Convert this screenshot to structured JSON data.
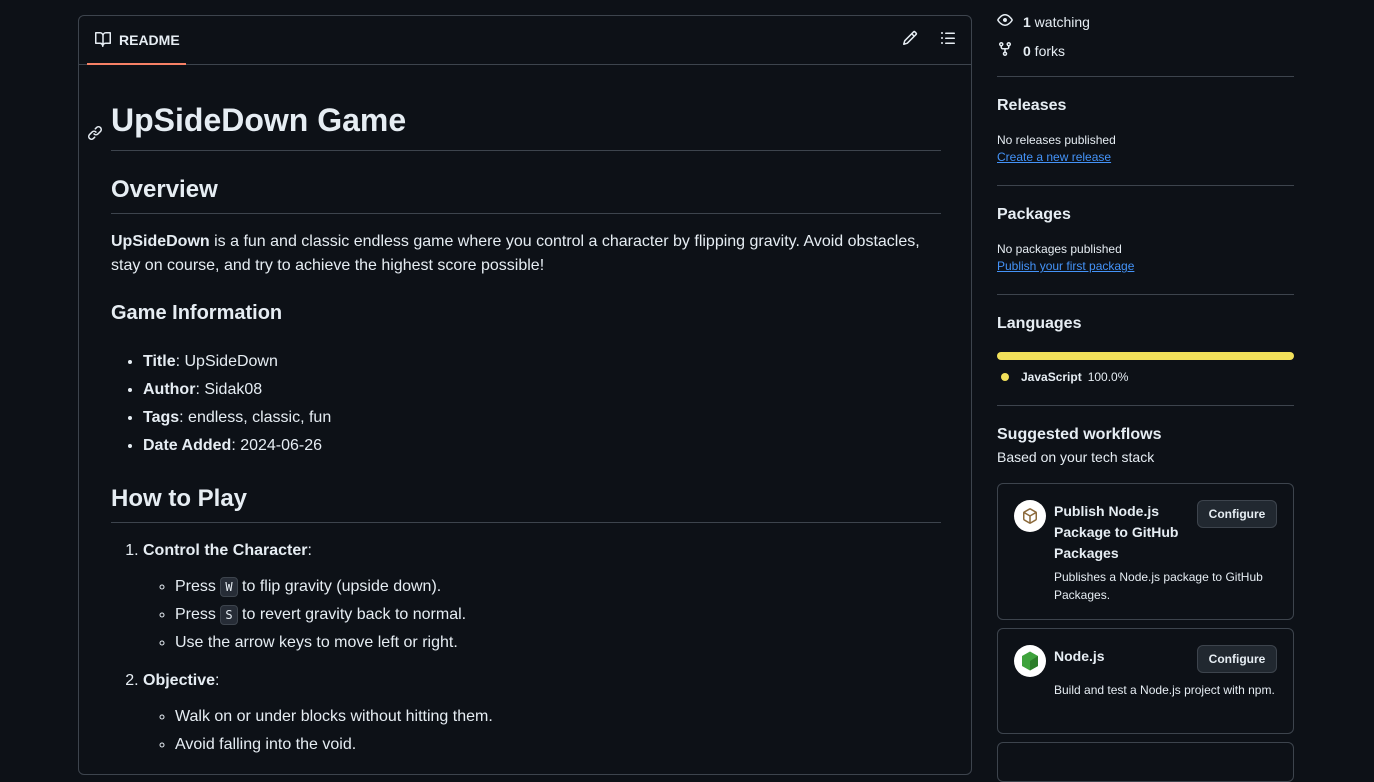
{
  "readme": {
    "tab_label": "README",
    "title": "UpSideDown Game",
    "overview_heading": "Overview",
    "overview_bold": "UpSideDown",
    "overview_text": " is a fun and classic endless game where you control a character by flipping gravity. Avoid obstacles, stay on course, and try to achieve the highest score possible!",
    "info_heading": "Game Information",
    "info": [
      {
        "label": "Title",
        "value": ": UpSideDown"
      },
      {
        "label": "Author",
        "value": ": Sidak08"
      },
      {
        "label": "Tags",
        "value": ": endless, classic, fun"
      },
      {
        "label": "Date Added",
        "value": ": 2024-06-26"
      }
    ],
    "howto_heading": "How to Play",
    "steps": [
      {
        "label": "Control the Character",
        "suffix": ":",
        "items": [
          {
            "pre": "Press ",
            "key": "W",
            "post": " to flip gravity (upside down)."
          },
          {
            "pre": "Press ",
            "key": "S",
            "post": " to revert gravity back to normal."
          },
          {
            "pre": "Use the arrow keys to move left or right.",
            "key": "",
            "post": ""
          }
        ]
      },
      {
        "label": "Objective",
        "suffix": ":",
        "items": [
          {
            "pre": "Walk on or under blocks without hitting them.",
            "key": "",
            "post": ""
          },
          {
            "pre": "Avoid falling into the void.",
            "key": "",
            "post": ""
          }
        ]
      }
    ]
  },
  "sidebar": {
    "watching_count": "1",
    "watching_label": " watching",
    "forks_count": "0",
    "forks_label": " forks",
    "releases": {
      "heading": "Releases",
      "status": "No releases published",
      "link": "Create a new release"
    },
    "packages": {
      "heading": "Packages",
      "status": "No packages published",
      "link": "Publish your first package"
    },
    "languages": {
      "heading": "Languages",
      "name": "JavaScript",
      "percent": "100.0%",
      "color": "#f1e05a"
    },
    "workflows": {
      "heading": "Suggested workflows",
      "subheading": "Based on your tech stack",
      "cards": [
        {
          "title": "Publish Node.js Package to GitHub Packages",
          "desc": "Publishes a Node.js package to GitHub Packages.",
          "button": "Configure",
          "icon": "package-icon"
        },
        {
          "title": "Node.js",
          "desc": "Build and test a Node.js project with npm.",
          "button": "Configure",
          "icon": "nodejs-icon"
        }
      ]
    }
  },
  "colors": {
    "accent_tab": "#f78166",
    "link": "#4493f8",
    "background": "#0d1117"
  }
}
